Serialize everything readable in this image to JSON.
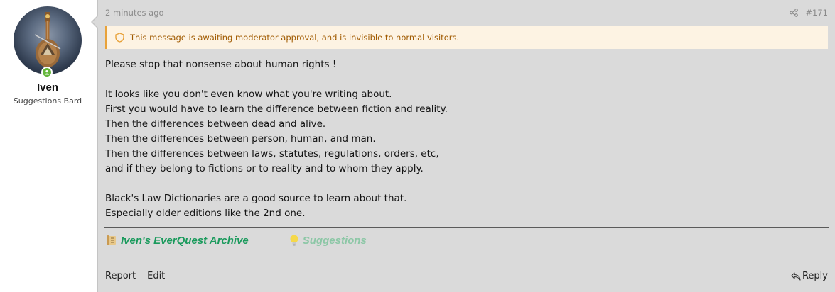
{
  "user": {
    "name": "Iven",
    "title": "Suggestions Bard"
  },
  "post": {
    "time": "2 minutes ago",
    "number": "#171",
    "notice": "This message is awaiting moderator approval, and is invisible to normal visitors.",
    "paragraphs": [
      [
        "Please stop that nonsense about human rights !"
      ],
      [
        "It looks like you don't even know what you're writing about.",
        "First you would have to learn the difference between fiction and reality.",
        "Then the differences between dead and alive.",
        "Then the differences between person, human, and man.",
        "Then the differences between laws, statutes, regulations, orders, etc,",
        "and if they belong to fictions or to reality and to whom they apply."
      ],
      [
        "Black's Law Dictionaries are a good source to learn about that.",
        "Especially older editions like the 2nd one."
      ]
    ]
  },
  "signature": {
    "link1": "Iven's EverQuest Archive",
    "link2": "Suggestions",
    "colors": {
      "link1": "#1a9a5c",
      "link2": "#8cc7a6"
    }
  },
  "actions": {
    "report": "Report",
    "edit": "Edit",
    "reply": "Reply"
  },
  "colors": {
    "post_bg": "#dadada",
    "notice_bg": "#fdf3e3",
    "notice_text": "#a05a00",
    "online": "#63b63a"
  }
}
